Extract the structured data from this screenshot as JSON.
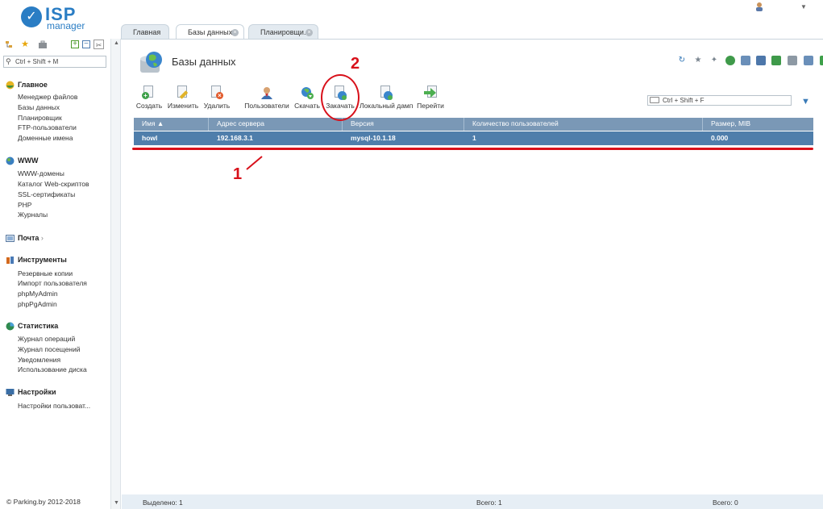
{
  "logo": {
    "brand": "ISP",
    "product": "manager"
  },
  "tabs": [
    {
      "label": "Главная"
    },
    {
      "label": "Базы данных"
    },
    {
      "label": "Планировщи..."
    }
  ],
  "sidebar": {
    "search_placeholder": "Ctrl + Shift + M",
    "groups": [
      {
        "title": "Главное",
        "items": [
          "Менеджер файлов",
          "Базы данных",
          "Планировщик",
          "FTP-пользователи",
          "Доменные имена"
        ]
      },
      {
        "title": "WWW",
        "items": [
          "WWW-домены",
          "Каталог Web-скриптов",
          "SSL-сертификаты",
          "PHP",
          "Журналы"
        ]
      },
      {
        "title": "Почта",
        "items": []
      },
      {
        "title": "Инструменты",
        "items": [
          "Резервные копии",
          "Импорт пользователя",
          "phpMyAdmin",
          "phpPgAdmin"
        ]
      },
      {
        "title": "Статистика",
        "items": [
          "Журнал операций",
          "Журнал посещений",
          "Уведомления",
          "Использование диска"
        ]
      },
      {
        "title": "Настройки",
        "items": [
          "Настройки пользоват..."
        ]
      }
    ],
    "copyright": "© Parking.by 2012-2018"
  },
  "page": {
    "title": "Базы данных"
  },
  "toolbar": [
    {
      "label": "Создать",
      "icon": "create-icon"
    },
    {
      "label": "Изменить",
      "icon": "edit-icon"
    },
    {
      "label": "Удалить",
      "icon": "delete-icon"
    },
    {
      "label": "Пользователи",
      "icon": "users-icon"
    },
    {
      "label": "Скачать",
      "icon": "download-icon"
    },
    {
      "label": "Закачать",
      "icon": "upload-icon"
    },
    {
      "label": "Локальный дамп",
      "icon": "local-dump-icon"
    },
    {
      "label": "Перейти",
      "icon": "goto-icon"
    }
  ],
  "filter": {
    "placeholder": "Ctrl + Shift + F"
  },
  "table": {
    "columns": [
      "Имя ▲",
      "Адрес сервера",
      "Версия",
      "Количество пользователей",
      "Размер, MIB"
    ],
    "rows": [
      [
        "howl",
        "192.168.3.1",
        "mysql-10.1.18",
        "1",
        "0.000"
      ]
    ]
  },
  "status": {
    "selected": "Выделено: 1",
    "total_users": "Всего: 1",
    "total_size": "Всего: 0"
  },
  "annotations": {
    "label_1": "1",
    "label_2": "2",
    "color": "#d8101a"
  },
  "colors": {
    "brand": "#2a7dc4",
    "header": "#7a98b6",
    "selected_row": "#4f7eab"
  }
}
